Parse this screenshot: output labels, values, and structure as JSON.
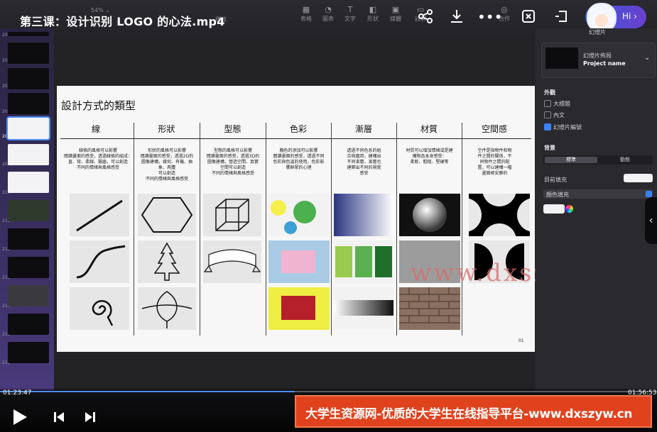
{
  "video": {
    "title": "第三课：设计识别 LOGO 的心法.mp4",
    "current_time": "01:23:47",
    "total_time": "01:56:53",
    "progress": 0.449
  },
  "toolbar": {
    "zoom": "54% ⌄",
    "play": "播放",
    "tools": [
      "表格",
      "圖表",
      "文字",
      "形狀",
      "媒體",
      "註解",
      "合作"
    ],
    "hi_label": "Hi"
  },
  "slide_numbers": [
    "204",
    "205",
    "206",
    "207",
    "208",
    "209",
    "210",
    "211",
    "212",
    "213",
    "214",
    "215",
    "216"
  ],
  "slide": {
    "title": "設計方式的類型",
    "page": "01",
    "categories": [
      {
        "label": "線",
        "desc": [
          "線條的風格可以影響",
          "閱讀畫面的感受，透過線條的組成：",
          "直、彎、柔線、鋸齒，可以創造",
          "不同的情緒與風格感受"
        ]
      },
      {
        "label": "形狀",
        "desc": [
          "形狀的風格可以影響",
          "閱讀畫面的感受，透過2D的",
          "圖像建構，幾何、有機、抽",
          "象、具體",
          "可以創造",
          "不同的情緒與風格感受"
        ]
      },
      {
        "label": "型態",
        "desc": [
          "型態的風格可以影響",
          "閱讀畫面的感受，透過3D的",
          "圖像建構，營造空間、真實",
          "空間可以創造",
          "不同的情緒與風格感受"
        ]
      },
      {
        "label": "色彩",
        "desc": [
          "顏色的添加可以影響",
          "閱讀畫面的感受，透過不同",
          "色彩與色溫的使用，色彩影",
          "響群眾的心理"
        ]
      },
      {
        "label": "漸層",
        "desc": [
          "透過不同色系的組",
          "合與趨用，建構出",
          "不同漸層，漸層也",
          "建築出不同的視覺",
          "感受"
        ]
      },
      {
        "label": "材質",
        "desc": [
          "材質可以增加情緒或是建",
          "構物品本身感受：",
          "柔軟、粗糙、堅硬等"
        ]
      },
      {
        "label": "空間感",
        "desc": [
          "空件是指物件和物",
          "件之間的關係，不",
          "同物件之間的配",
          "置，可以建構一幅",
          "畫面帳安靜的"
        ]
      }
    ]
  },
  "watermark": "www.dxszyw.cn",
  "inspector": {
    "tab": "幻燈片",
    "layout_title": "幻燈片佈局",
    "layout_name": "Project name",
    "appearance_head": "外觀",
    "options": [
      {
        "label": "大標題",
        "checked": false
      },
      {
        "label": "內文",
        "checked": false
      },
      {
        "label": "幻燈片編號",
        "checked": true
      }
    ],
    "background_head": "背景",
    "seg_a": "標準",
    "seg_b": "動態",
    "fill_label": "目前填充",
    "fill_select": "顏色填充"
  },
  "banner": "大学生资源网-优质的大学生在线指导平台-www.dxszyw.cn",
  "colors": {
    "accent": "#4d8dff",
    "banner": "#e0421e"
  }
}
